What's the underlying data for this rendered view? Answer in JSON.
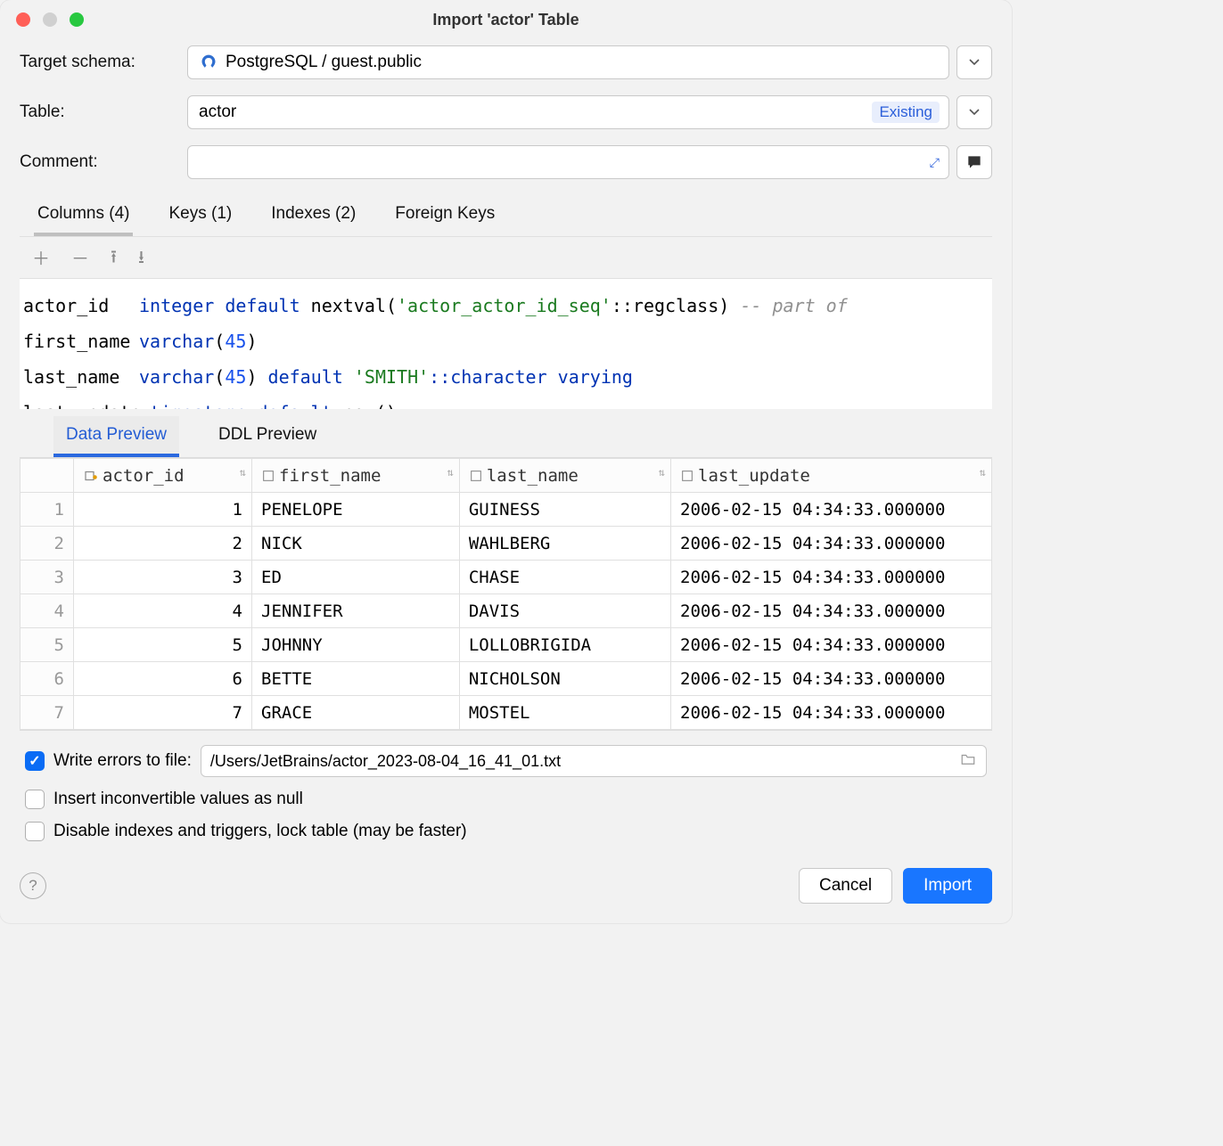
{
  "window": {
    "title": "Import 'actor' Table"
  },
  "form": {
    "target_schema_label": "Target schema:",
    "target_schema_value": "PostgreSQL / guest.public",
    "table_label": "Table:",
    "table_value": "actor",
    "table_badge": "Existing",
    "comment_label": "Comment:",
    "comment_value": ""
  },
  "tabs": {
    "columns": "Columns (4)",
    "keys": "Keys (1)",
    "indexes": "Indexes (2)",
    "foreign_keys": "Foreign Keys"
  },
  "columns_def": [
    {
      "name": "actor_id",
      "type_kw": "integer",
      "rest": " default ",
      "fn": "nextval(",
      "lit": "'actor_actor_id_seq'",
      "cast": "::regclass)",
      "comment": " -- part of"
    },
    {
      "name": "first_name",
      "type_kw": "varchar",
      "paren_open": "(",
      "num": "45",
      "paren_close": ")"
    },
    {
      "name": "last_name",
      "type_kw": "varchar",
      "paren_open": "(",
      "num": "45",
      "paren_close": ")",
      "rest": " default ",
      "lit": "'SMITH'",
      "cast": "::character varying"
    },
    {
      "name": "last_update",
      "type_kw": "timestamp",
      "rest": " default ",
      "fn": "now()"
    }
  ],
  "subtabs": {
    "data_preview": "Data Preview",
    "ddl_preview": "DDL Preview"
  },
  "grid": {
    "headers": [
      "actor_id",
      "first_name",
      "last_name",
      "last_update"
    ],
    "rows": [
      {
        "n": "1",
        "actor_id": "1",
        "first_name": "PENELOPE",
        "last_name": "GUINESS",
        "last_update": "2006-02-15 04:34:33.000000"
      },
      {
        "n": "2",
        "actor_id": "2",
        "first_name": "NICK",
        "last_name": "WAHLBERG",
        "last_update": "2006-02-15 04:34:33.000000"
      },
      {
        "n": "3",
        "actor_id": "3",
        "first_name": "ED",
        "last_name": "CHASE",
        "last_update": "2006-02-15 04:34:33.000000"
      },
      {
        "n": "4",
        "actor_id": "4",
        "first_name": "JENNIFER",
        "last_name": "DAVIS",
        "last_update": "2006-02-15 04:34:33.000000"
      },
      {
        "n": "5",
        "actor_id": "5",
        "first_name": "JOHNNY",
        "last_name": "LOLLOBRIGIDA",
        "last_update": "2006-02-15 04:34:33.000000"
      },
      {
        "n": "6",
        "actor_id": "6",
        "first_name": "BETTE",
        "last_name": "NICHOLSON",
        "last_update": "2006-02-15 04:34:33.000000"
      },
      {
        "n": "7",
        "actor_id": "7",
        "first_name": "GRACE",
        "last_name": "MOSTEL",
        "last_update": "2006-02-15 04:34:33.000000"
      }
    ]
  },
  "options": {
    "write_errors_label": "Write errors to file:",
    "write_errors_path": "/Users/JetBrains/actor_2023-08-04_16_41_01.txt",
    "insert_null_label": "Insert inconvertible values as null",
    "disable_idx_label": "Disable indexes and triggers, lock table (may be faster)"
  },
  "footer": {
    "cancel": "Cancel",
    "import": "Import"
  }
}
